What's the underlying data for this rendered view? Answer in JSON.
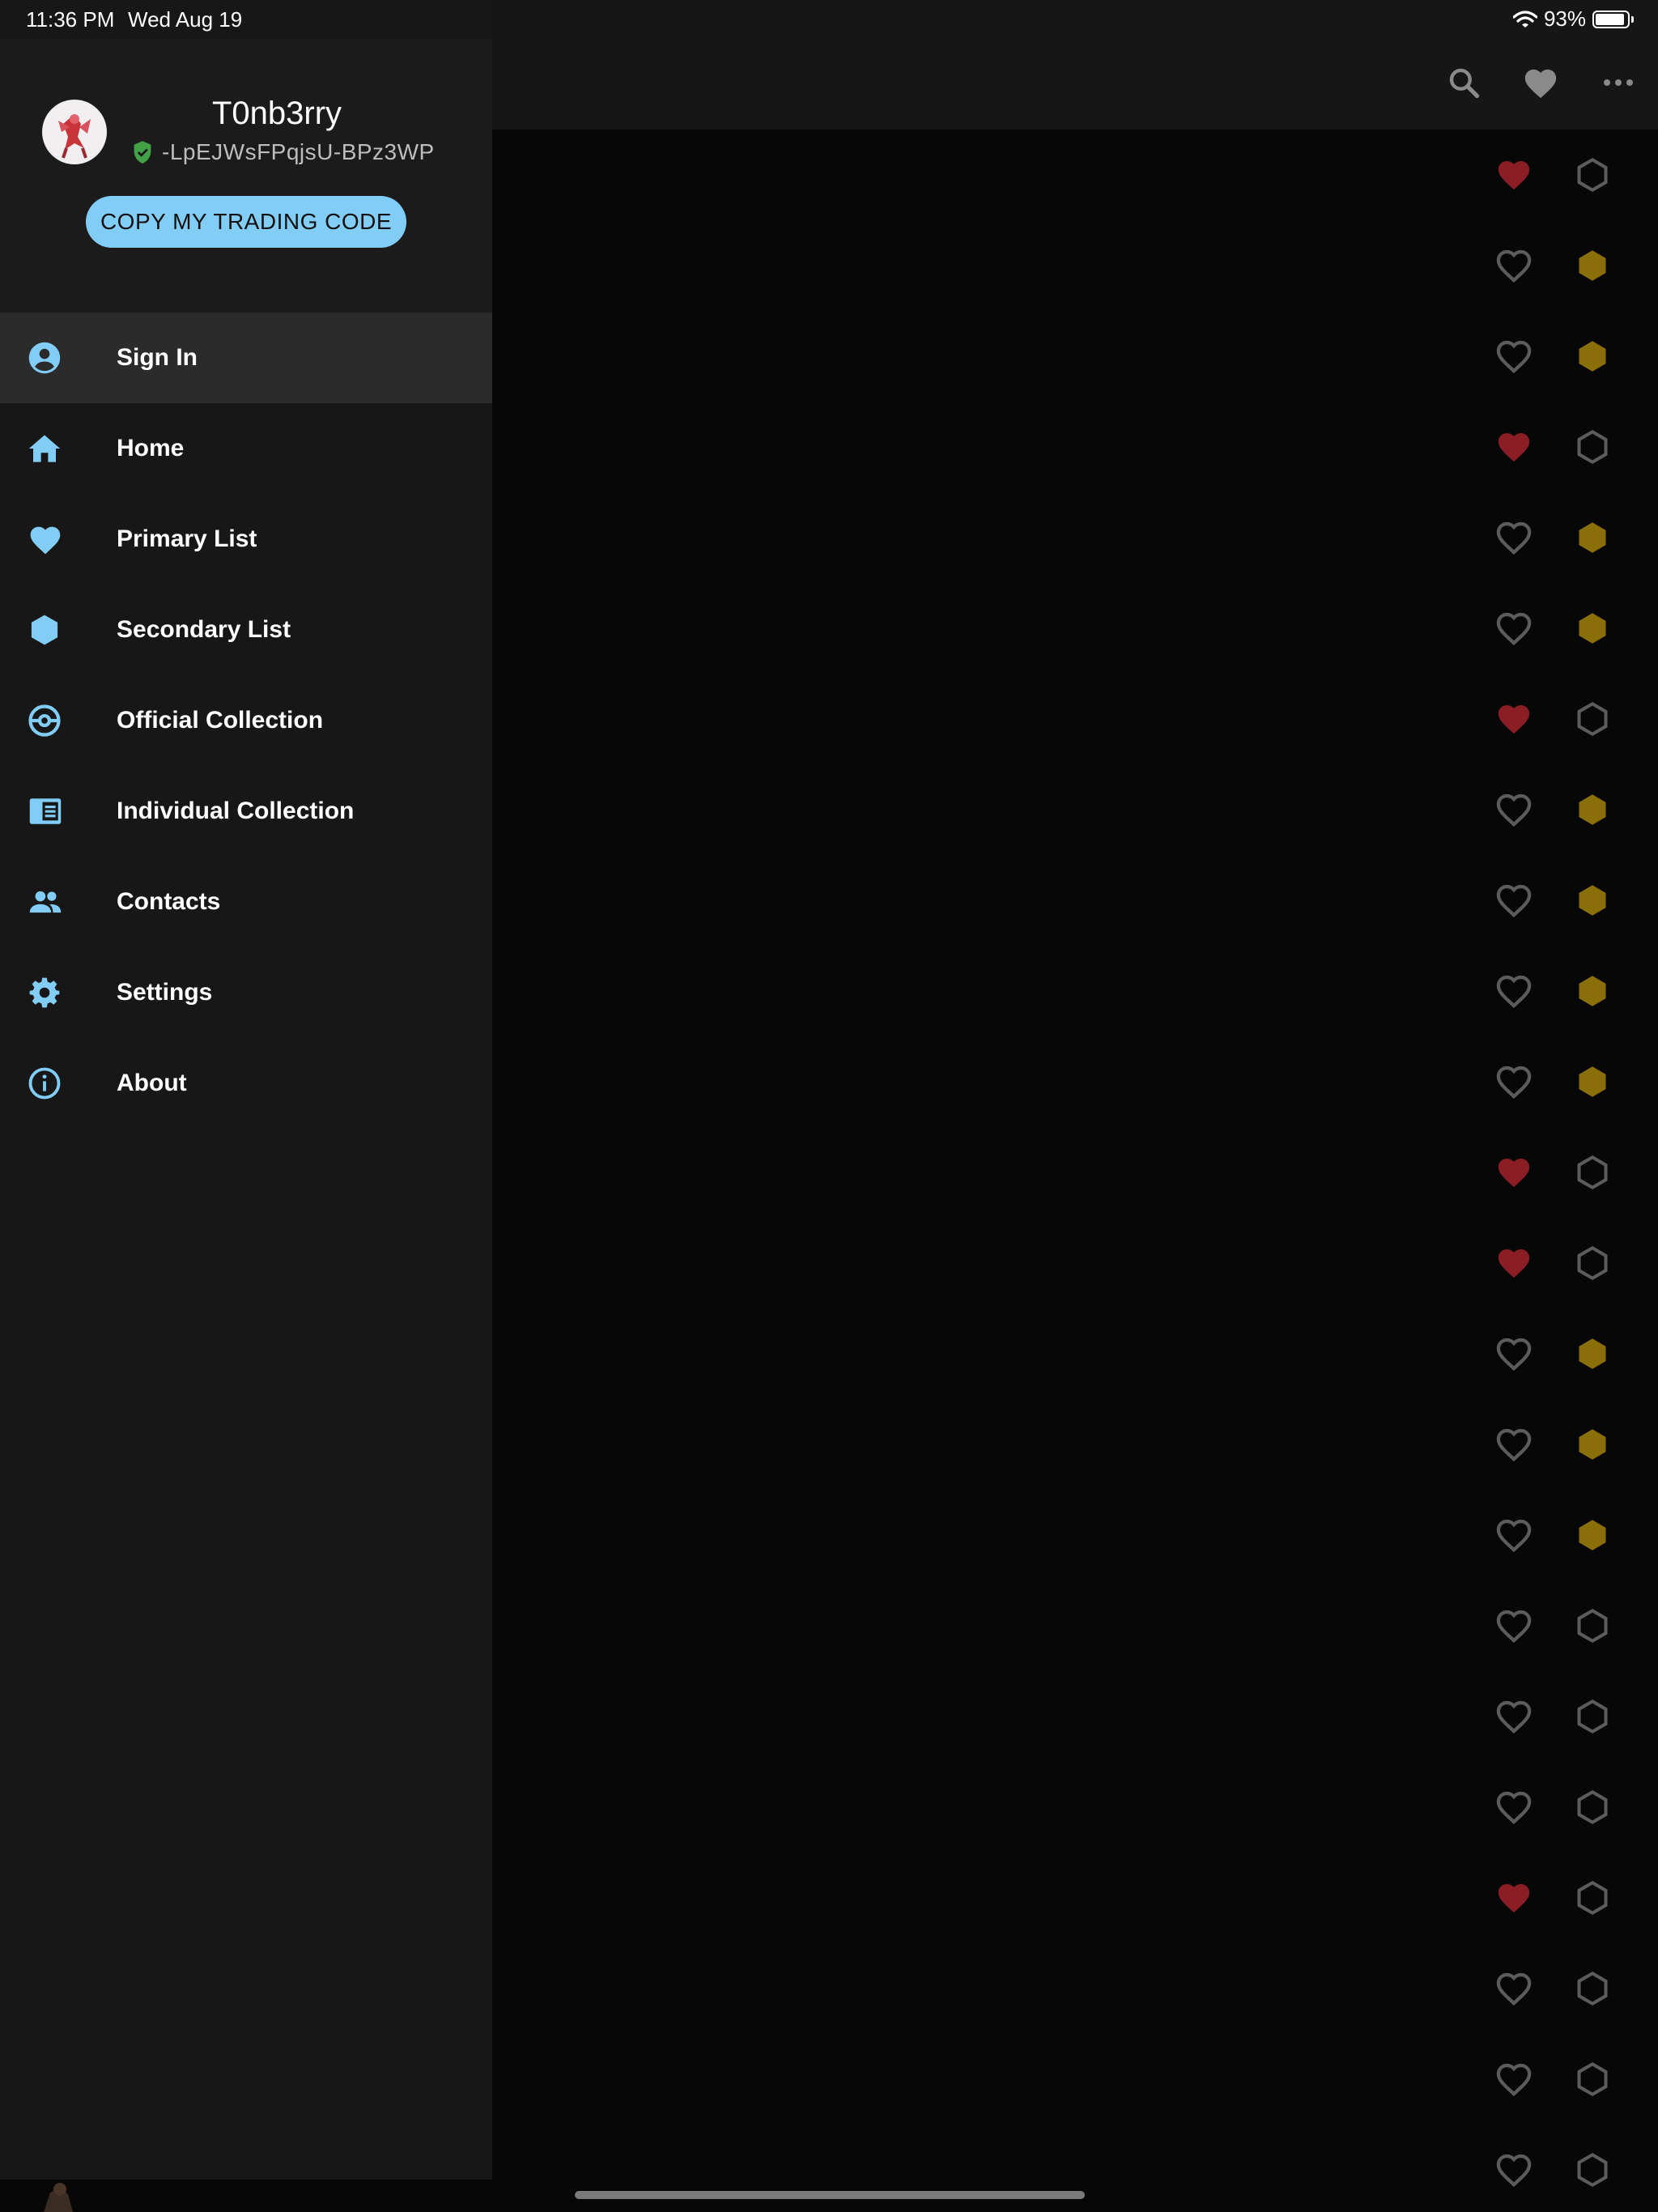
{
  "status_bar": {
    "time": "11:36 PM",
    "date": "Wed Aug 19",
    "battery_percent": "93%",
    "battery_level": 0.93,
    "icons": [
      "wifi-icon",
      "battery-icon"
    ]
  },
  "app_bar": {
    "actions": [
      {
        "name": "search-icon",
        "label": "Search"
      },
      {
        "name": "heart-icon",
        "label": "Favorites"
      },
      {
        "name": "more-options-icon",
        "label": "More"
      }
    ]
  },
  "drawer": {
    "header": {
      "username": "T0nb3rry",
      "trading_code": "-LpEJWsFPqjsU-BPz3WP",
      "verified_icon": "shield-check-icon",
      "avatar_icon": "avatar-pokemon-icon",
      "copy_button_label": "COPY MY TRADING CODE"
    },
    "menu": [
      {
        "id": "sign-in",
        "label": "Sign In",
        "icon": "account-circle-icon",
        "active": true
      },
      {
        "id": "home",
        "label": "Home",
        "icon": "home-icon",
        "active": false
      },
      {
        "id": "primary-list",
        "label": "Primary List",
        "icon": "heart-icon",
        "active": false
      },
      {
        "id": "secondary-list",
        "label": "Secondary List",
        "icon": "hexagon-icon",
        "active": false
      },
      {
        "id": "official-collection",
        "label": "Official Collection",
        "icon": "pokeball-icon",
        "active": false
      },
      {
        "id": "individual-collection",
        "label": "Individual Collection",
        "icon": "collection-book-icon",
        "active": false
      },
      {
        "id": "contacts",
        "label": "Contacts",
        "icon": "people-icon",
        "active": false
      },
      {
        "id": "settings",
        "label": "Settings",
        "icon": "gear-icon",
        "active": false
      },
      {
        "id": "about",
        "label": "About",
        "icon": "info-icon",
        "active": false
      }
    ]
  },
  "list": {
    "rows": [
      {
        "primary": true,
        "secondary": false
      },
      {
        "primary": false,
        "secondary": true
      },
      {
        "primary": false,
        "secondary": true
      },
      {
        "primary": true,
        "secondary": false
      },
      {
        "primary": false,
        "secondary": true
      },
      {
        "primary": false,
        "secondary": true
      },
      {
        "primary": true,
        "secondary": false
      },
      {
        "primary": false,
        "secondary": true
      },
      {
        "primary": false,
        "secondary": true
      },
      {
        "primary": false,
        "secondary": true
      },
      {
        "primary": false,
        "secondary": true
      },
      {
        "primary": true,
        "secondary": false
      },
      {
        "primary": true,
        "secondary": false
      },
      {
        "primary": false,
        "secondary": true
      },
      {
        "primary": false,
        "secondary": true
      },
      {
        "primary": false,
        "secondary": true
      },
      {
        "primary": false,
        "secondary": false
      },
      {
        "primary": false,
        "secondary": false
      },
      {
        "primary": false,
        "secondary": false
      },
      {
        "primary": true,
        "secondary": false
      },
      {
        "primary": false,
        "secondary": false
      },
      {
        "primary": false,
        "secondary": false
      },
      {
        "primary": false,
        "secondary": false
      }
    ]
  },
  "colors": {
    "accent": "#82cdf6",
    "heart_active": "#8b1e24",
    "hex_active": "#8a6e0a",
    "icon_inactive": "#5c5c5c",
    "verified": "#43a047"
  }
}
